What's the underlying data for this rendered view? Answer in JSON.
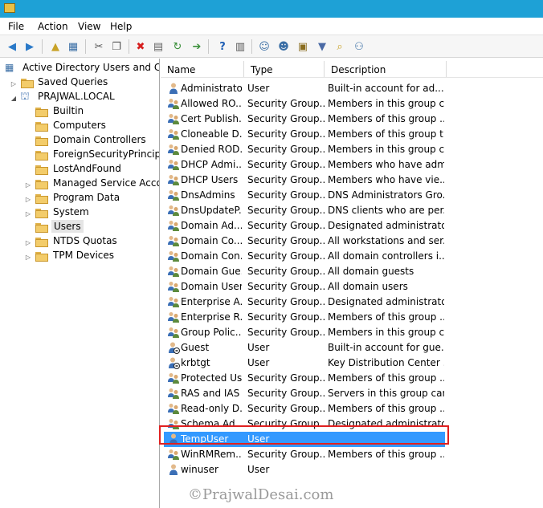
{
  "menu": [
    "File",
    "Action",
    "View",
    "Help"
  ],
  "tree": {
    "root": "Active Directory Users and Com",
    "saved_queries": "Saved Queries",
    "domain": "PRAJWAL.LOCAL",
    "children": [
      "Builtin",
      "Computers",
      "Domain Controllers",
      "ForeignSecurityPrincipals",
      "LostAndFound",
      "Managed Service Accoun",
      "Program Data",
      "System",
      "Users",
      "NTDS Quotas",
      "TPM Devices"
    ],
    "selected": "Users"
  },
  "columns": {
    "name": "Name",
    "type": "Type",
    "description": "Description"
  },
  "rows": [
    {
      "name": "Administrator",
      "type": "User",
      "description": "Built-in account for ad...",
      "kind": "user"
    },
    {
      "name": "Allowed RO...",
      "type": "Security Group...",
      "description": "Members in this group c...",
      "kind": "group"
    },
    {
      "name": "Cert Publish...",
      "type": "Security Group...",
      "description": "Members of this group ...",
      "kind": "group"
    },
    {
      "name": "Cloneable D...",
      "type": "Security Group...",
      "description": "Members of this group t...",
      "kind": "group"
    },
    {
      "name": "Denied ROD...",
      "type": "Security Group...",
      "description": "Members in this group c...",
      "kind": "group"
    },
    {
      "name": "DHCP Admi...",
      "type": "Security Group...",
      "description": "Members who have adm...",
      "kind": "group"
    },
    {
      "name": "DHCP Users",
      "type": "Security Group...",
      "description": "Members who have vie...",
      "kind": "group"
    },
    {
      "name": "DnsAdmins",
      "type": "Security Group...",
      "description": "DNS Administrators Gro...",
      "kind": "group"
    },
    {
      "name": "DnsUpdateP...",
      "type": "Security Group...",
      "description": "DNS clients who are per...",
      "kind": "group"
    },
    {
      "name": "Domain Ad...",
      "type": "Security Group...",
      "description": "Designated administrato...",
      "kind": "group"
    },
    {
      "name": "Domain Co...",
      "type": "Security Group...",
      "description": "All workstations and ser...",
      "kind": "group"
    },
    {
      "name": "Domain Con...",
      "type": "Security Group...",
      "description": "All domain controllers i...",
      "kind": "group"
    },
    {
      "name": "Domain Gue...",
      "type": "Security Group...",
      "description": "All domain guests",
      "kind": "group"
    },
    {
      "name": "Domain Users",
      "type": "Security Group...",
      "description": "All domain users",
      "kind": "group"
    },
    {
      "name": "Enterprise A...",
      "type": "Security Group...",
      "description": "Designated administrato...",
      "kind": "group"
    },
    {
      "name": "Enterprise R...",
      "type": "Security Group...",
      "description": "Members of this group ...",
      "kind": "group"
    },
    {
      "name": "Group Polic...",
      "type": "Security Group...",
      "description": "Members in this group c...",
      "kind": "group"
    },
    {
      "name": "Guest",
      "type": "User",
      "description": "Built-in account for gue...",
      "kind": "user-disabled"
    },
    {
      "name": "krbtgt",
      "type": "User",
      "description": "Key Distribution Center ...",
      "kind": "user-disabled"
    },
    {
      "name": "Protected Us...",
      "type": "Security Group...",
      "description": "Members of this group ...",
      "kind": "group"
    },
    {
      "name": "RAS and IAS ...",
      "type": "Security Group...",
      "description": "Servers in this group can...",
      "kind": "group"
    },
    {
      "name": "Read-only D...",
      "type": "Security Group...",
      "description": "Members of this group ...",
      "kind": "group"
    },
    {
      "name": "Schema Ad...",
      "type": "Security Group...",
      "description": "Designated administrato...",
      "kind": "group"
    },
    {
      "name": "TempUser",
      "type": "User",
      "description": "",
      "kind": "user"
    },
    {
      "name": "WinRMRem...",
      "type": "Security Group...",
      "description": "Members of this group ...",
      "kind": "group"
    },
    {
      "name": "winuser",
      "type": "User",
      "description": "",
      "kind": "user"
    }
  ],
  "selected_row": "TempUser",
  "watermark": "©PrajwalDesai.com",
  "colors": {
    "titlebar": "#1ea1d6",
    "selection": "#3399ff",
    "highlight_box": "#e02020"
  }
}
